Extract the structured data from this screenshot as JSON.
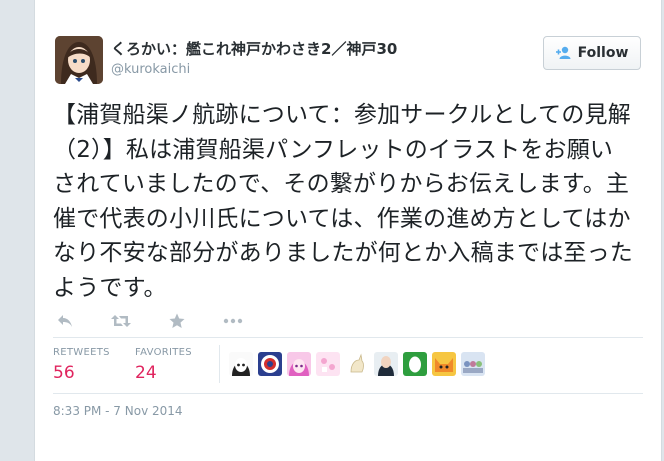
{
  "user": {
    "display_name": "くろかい：艦これ神戸かわさき2／神戸30",
    "handle": "@kurokaichi"
  },
  "follow_button": {
    "label": "Follow"
  },
  "tweet": {
    "text": "【浦賀船渠ノ航跡について：参加サークルとしての見解（2）】私は浦賀船渠パンフレットのイラストをお願いされていましたので、その繋がりからお伝えします。主催で代表の小川氏については、作業の進め方としてはかなり不安な部分がありましたが何とか入稿までは至ったようです。"
  },
  "actions": [
    "reply-icon",
    "retweet-icon",
    "favorite-icon",
    "more-icon"
  ],
  "stats": {
    "retweets_label": "RETWEETS",
    "retweets_value": "56",
    "favorites_label": "FAVORITES",
    "favorites_value": "24"
  },
  "timestamp": "8:33 PM - 7 Nov 2014",
  "colors": {
    "accent": "#e0245e",
    "muted": "#8899a6",
    "text": "#292f33",
    "follow_icon": "#55acee"
  }
}
